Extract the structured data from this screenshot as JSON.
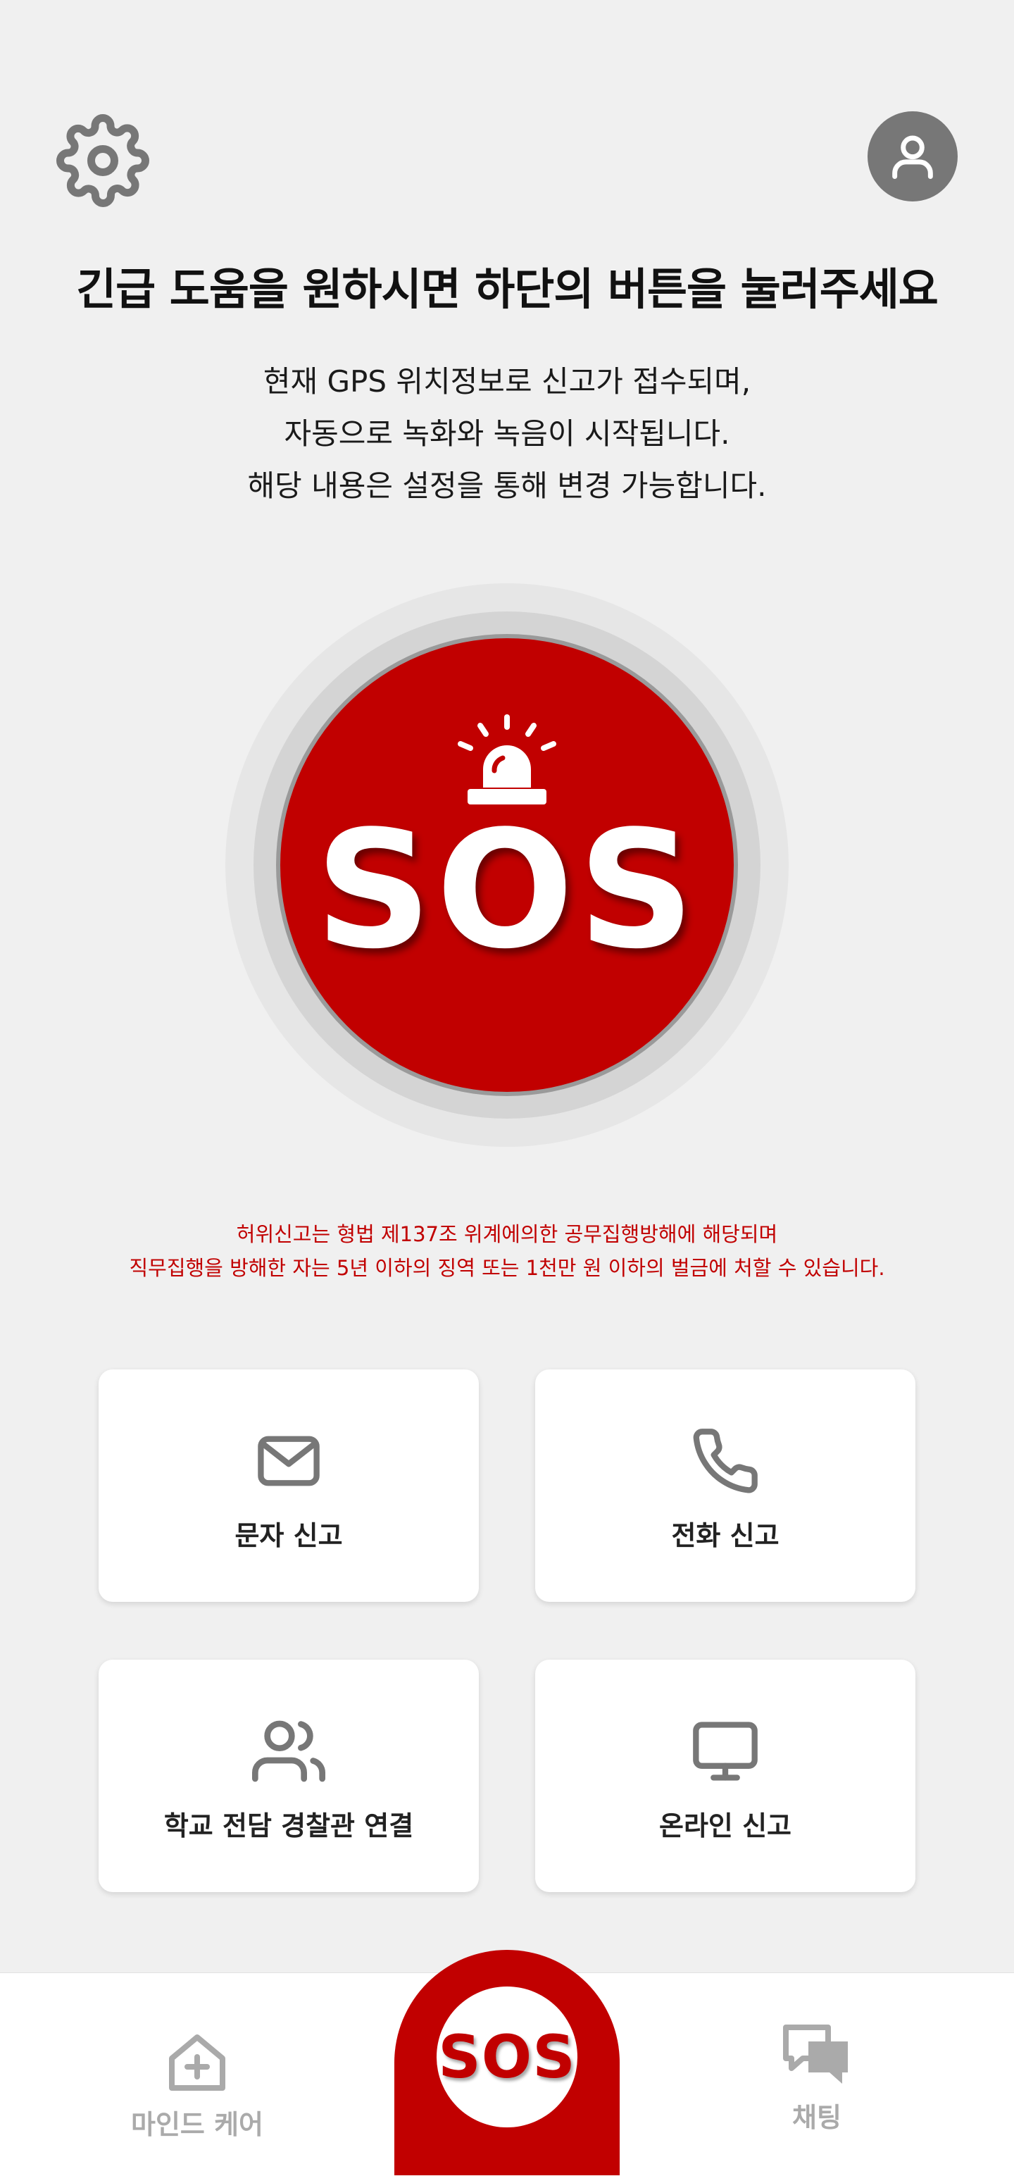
{
  "header": {
    "settings_icon": "gear-icon",
    "profile_icon": "user-icon"
  },
  "headline": "긴급 도움을 원하시면 하단의 버튼을 눌러주세요",
  "description": {
    "line1": "현재 GPS 위치정보로 신고가 접수되며,",
    "line2": "자동으로 녹화와 녹음이 시작됩니다.",
    "line3": "해당 내용은 설정을 통해 변경 가능합니다."
  },
  "sos_button": {
    "label": "SOS",
    "icon": "siren-icon",
    "color": "#c10000"
  },
  "warning": {
    "line1": "허위신고는 형법 제137조 위계에의한 공무집행방해에 해당되며",
    "line2": "직무집행을 방해한 자는 5년 이하의 징역 또는 1천만 원 이하의 벌금에 처할 수 있습니다.",
    "color": "#c10000"
  },
  "actions": {
    "sms": {
      "label": "문자 신고",
      "icon": "envelope-icon"
    },
    "call": {
      "label": "전화 신고",
      "icon": "phone-icon"
    },
    "police": {
      "label": "학교 전담 경찰관 연결",
      "icon": "users-icon"
    },
    "online": {
      "label": "온라인 신고",
      "icon": "monitor-icon"
    }
  },
  "bottom_nav": {
    "mindcare": {
      "label": "마인드 케어",
      "icon": "house-plus-icon"
    },
    "sos": {
      "label": "SOS"
    },
    "chat": {
      "label": "채팅",
      "icon": "chat-bubbles-icon"
    }
  }
}
